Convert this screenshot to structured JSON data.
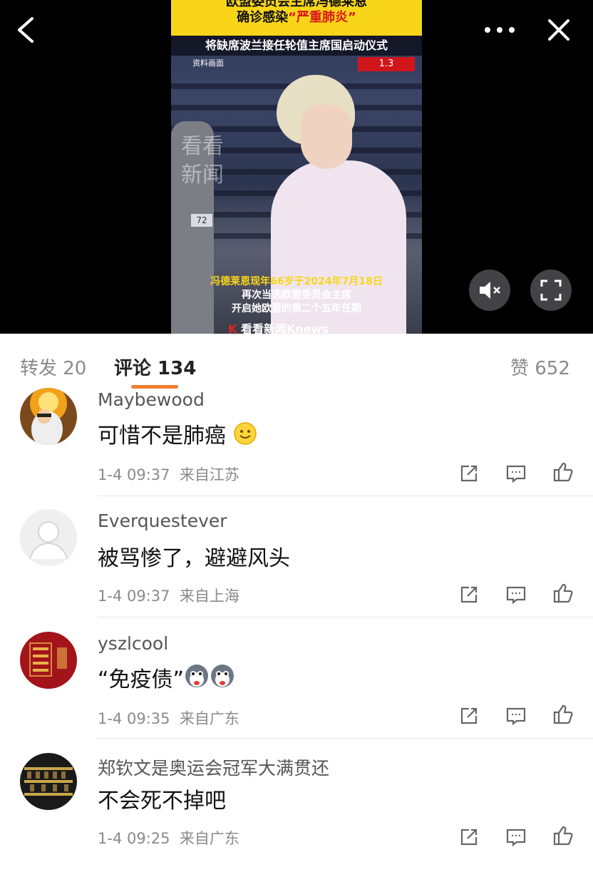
{
  "video": {
    "headline_line1": "欧盟委员会主席冯德莱恩",
    "headline_line2_prefix": "确诊感染",
    "headline_line2_red": "“严重肺炎”",
    "subheadline": "将缺席波兰接任轮值主席国启动仪式",
    "archive_label": "资料画面",
    "corner_badge": "1.3",
    "watermark": "看看新闻",
    "seat_number": "72",
    "caption_line1": "冯德莱恩现年66岁于2024年7月18日",
    "caption_line2": "再次当选欧盟委员会主席",
    "caption_line3": "开启她欧盟的第二个五年任期",
    "logo_text": "看看新闻Knews",
    "controls": {
      "back_icon": "chevron-left-icon",
      "more_icon": "more-dots-icon",
      "close_icon": "close-icon",
      "mute_icon": "speaker-mute-icon",
      "fullscreen_icon": "fullscreen-icon"
    }
  },
  "tabs": {
    "repost": "转发 20",
    "comments": "评论 134",
    "likes": "赞 652",
    "accent_color": "#f27e2c"
  },
  "comments": [
    {
      "username": "Maybewood",
      "text": "可惜不是肺癌",
      "emoji": "smile-emoji",
      "time": "1-4 09:37",
      "location": "来自江苏"
    },
    {
      "username": "Everquestever",
      "text": "被骂惨了，避避风头",
      "emoji": "",
      "time": "1-4 09:37",
      "location": "来自上海"
    },
    {
      "username": "yszlcool",
      "text": "“免疫债”",
      "emoji": "husky-emoji",
      "time": "1-4 09:35",
      "location": "来自广东"
    },
    {
      "username": "郑钦文是奥运会冠军大满贯还",
      "text": "不会死不掉吧",
      "emoji": "",
      "time": "1-4 09:25",
      "location": "来自广东"
    }
  ]
}
